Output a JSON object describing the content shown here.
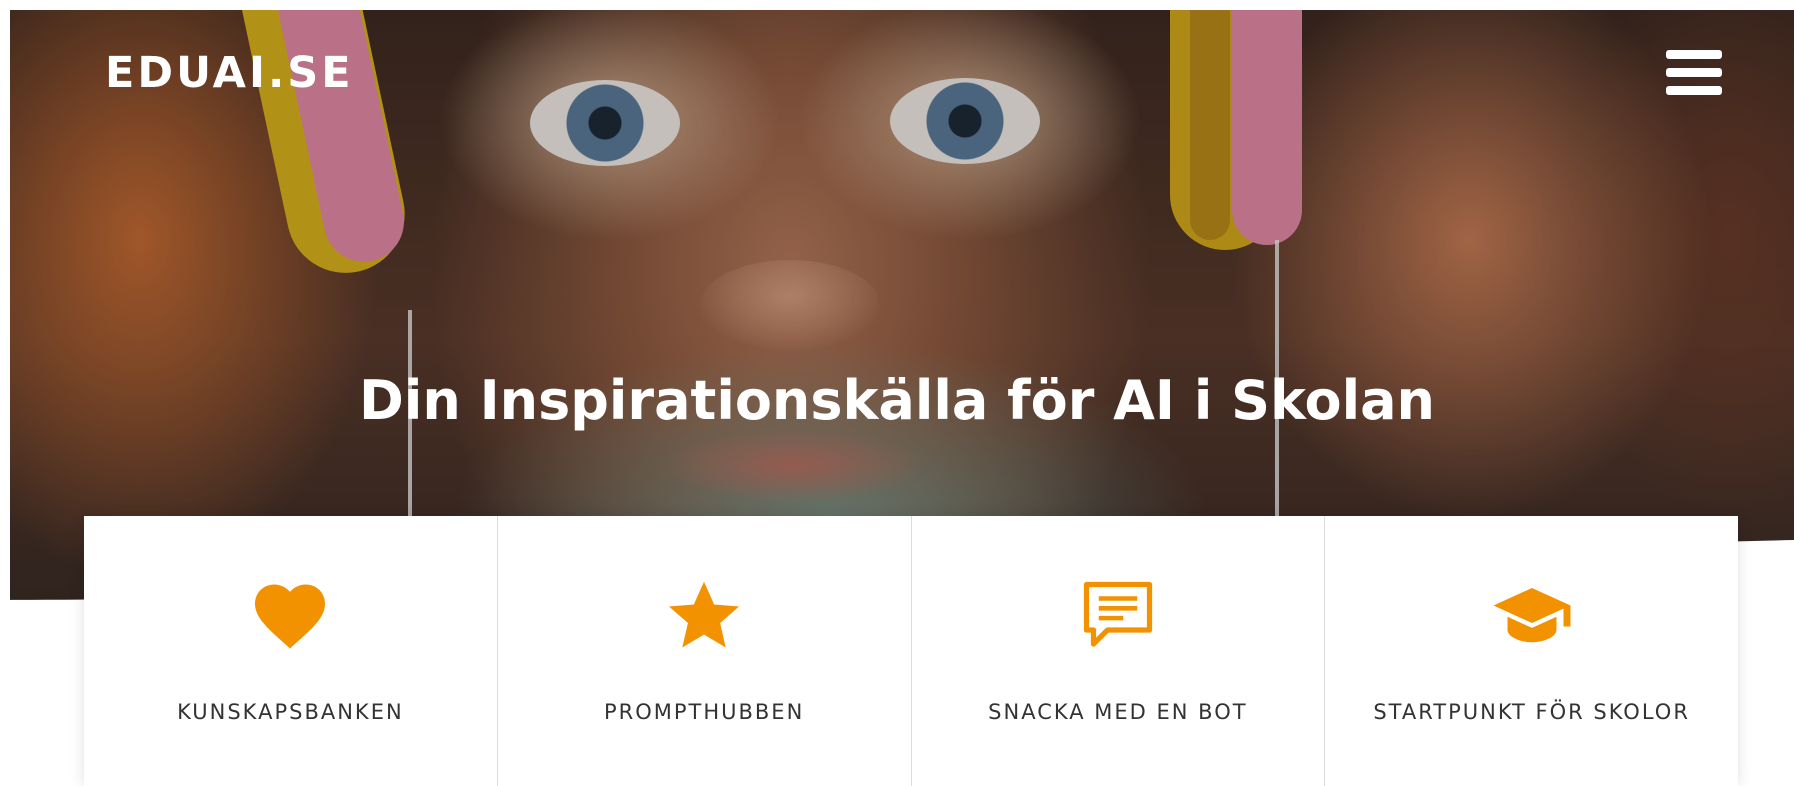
{
  "header": {
    "logo_text": "EDUAI.SE",
    "menu_icon": "hamburger-menu-icon"
  },
  "hero": {
    "title": "Din Inspirationskälla för AI i Skolan"
  },
  "features": [
    {
      "label": "KUNSKAPSBANKEN",
      "icon": "heart-icon"
    },
    {
      "label": "PROMPTHUBBEN",
      "icon": "star-icon"
    },
    {
      "label": "SNACKA MED EN BOT",
      "icon": "chat-bubble-icon"
    },
    {
      "label": "STARTPUNKT FÖR SKOLOR",
      "icon": "graduation-cap-icon"
    }
  ],
  "colors": {
    "accent": "#f39200",
    "text": "#333333",
    "hero_text": "#ffffff"
  }
}
